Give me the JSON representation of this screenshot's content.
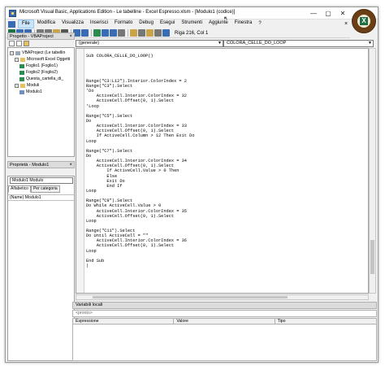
{
  "window": {
    "title": "Microsoft Visual Basic, Applications Edition - Le tabelline - Excel Espresso.xlsm - [Modulo1 (codice)]"
  },
  "title_controls": {
    "minimize": "—",
    "maximize": "▢",
    "close": "✕"
  },
  "menu": {
    "items": [
      "File",
      "Modifica",
      "Visualizza",
      "Inserisci",
      "Formato",
      "Debug",
      "Esegui",
      "Strumenti",
      "Aggiunte",
      "Finestra"
    ],
    "active": "File",
    "extra": "?",
    "close_glyph": "×"
  },
  "toolbar": {
    "buttons": [
      {
        "name": "excel-view",
        "color": "#1e7145"
      },
      {
        "name": "insert",
        "color": "#3a6bb5"
      },
      {
        "name": "save",
        "color": "#3a6bb5"
      },
      {
        "name": "cut",
        "color": "#777777"
      },
      {
        "name": "copy",
        "color": "#777777"
      },
      {
        "name": "paste",
        "color": "#c9a44a"
      },
      {
        "name": "find",
        "color": "#555555"
      },
      {
        "name": "undo",
        "color": "#3a6bb5"
      },
      {
        "name": "redo",
        "color": "#3a6bb5"
      },
      {
        "name": "run",
        "color": "#2f8a51"
      },
      {
        "name": "break",
        "color": "#3a6bb5"
      },
      {
        "name": "reset",
        "color": "#3a6bb5"
      },
      {
        "name": "design-mode",
        "color": "#777777"
      },
      {
        "name": "project-explorer",
        "color": "#c9a44a"
      },
      {
        "name": "properties",
        "color": "#777777"
      },
      {
        "name": "object-browser",
        "color": "#c9a44a"
      },
      {
        "name": "toolbox",
        "color": "#777777"
      },
      {
        "name": "help",
        "color": "#3a6bb5"
      }
    ],
    "status": "Riga 216, Col 1"
  },
  "project_pane": {
    "title": "Progetto - VBAProject",
    "close": "×",
    "tree": [
      {
        "label": "VBAProject (Le tabellin",
        "level": 0,
        "icon": "vba",
        "toggle": "−"
      },
      {
        "label": "Microsoft Excel Oggetti",
        "level": 1,
        "icon": "folder",
        "toggle": "−"
      },
      {
        "label": "Foglio1 (Foglio1)",
        "level": 2,
        "icon": "sheet",
        "toggle": ""
      },
      {
        "label": "Foglio2 (Foglio2)",
        "level": 2,
        "icon": "sheet",
        "toggle": ""
      },
      {
        "label": "Questa_cartella_di_",
        "level": 2,
        "icon": "sheet",
        "toggle": ""
      },
      {
        "label": "Moduli",
        "level": 1,
        "icon": "folder",
        "toggle": "−"
      },
      {
        "label": "Modulo1",
        "level": 2,
        "icon": "module",
        "toggle": ""
      }
    ]
  },
  "properties_pane": {
    "title": "Proprietà - Modulo1",
    "close": "×",
    "object_select": "Modulo1 Modulo",
    "tabs": [
      "Alfabetico",
      "Per categoria"
    ],
    "selected_tab": "Alfabetico",
    "row": "(Name) Modulo1"
  },
  "code_window": {
    "object_combo": "(generale)",
    "procedure_combo": "COLORA_CELLE_DO_LOOP",
    "lines": [
      "",
      "Sub COLORA_CELLE_DO_LOOP()",
      "",
      "",
      "",
      "",
      "Range(\"C3:L12\").Interior.ColorIndex = 2",
      "Range(\"C3\").Select",
      "'Do",
      "    ActiveCell.Interior.ColorIndex = 32",
      "    ActiveCell.Offset(0, 1).Select",
      "'Loop",
      "",
      "Range(\"C5\").Select",
      "Do",
      "    ActiveCell.Interior.ColorIndex = 33",
      "    ActiveCell.Offset(0, 1).Select",
      "    If ActiveCell.Column > 12 Then Exit Do",
      "Loop",
      "",
      "Range(\"C7\").Select",
      "Do",
      "    ActiveCell.Interior.ColorIndex = 34",
      "    ActiveCell.Offset(0, 1).Select",
      "        If ActiveCell.Value > 0 Then",
      "        Else",
      "        Exit Do",
      "        End If",
      "Loop",
      "",
      "Range(\"C9\").Select",
      "Do While ActiveCell.Value > 0",
      "    ActiveCell.Interior.ColorIndex = 35",
      "    ActiveCell.Offset(0, 1).Select",
      "Loop",
      "",
      "Range(\"C11\").Select",
      "Do Until ActiveCell = \"\"",
      "    ActiveCell.Interior.ColorIndex = 36",
      "    ActiveCell.Offset(0, 1).Select",
      "Loop",
      "",
      "End Sub",
      "|"
    ]
  },
  "locals_window": {
    "title": "Variabili locali",
    "context": "<pronto>",
    "columns": [
      "Espressione",
      "Valore",
      "Tipo"
    ]
  }
}
